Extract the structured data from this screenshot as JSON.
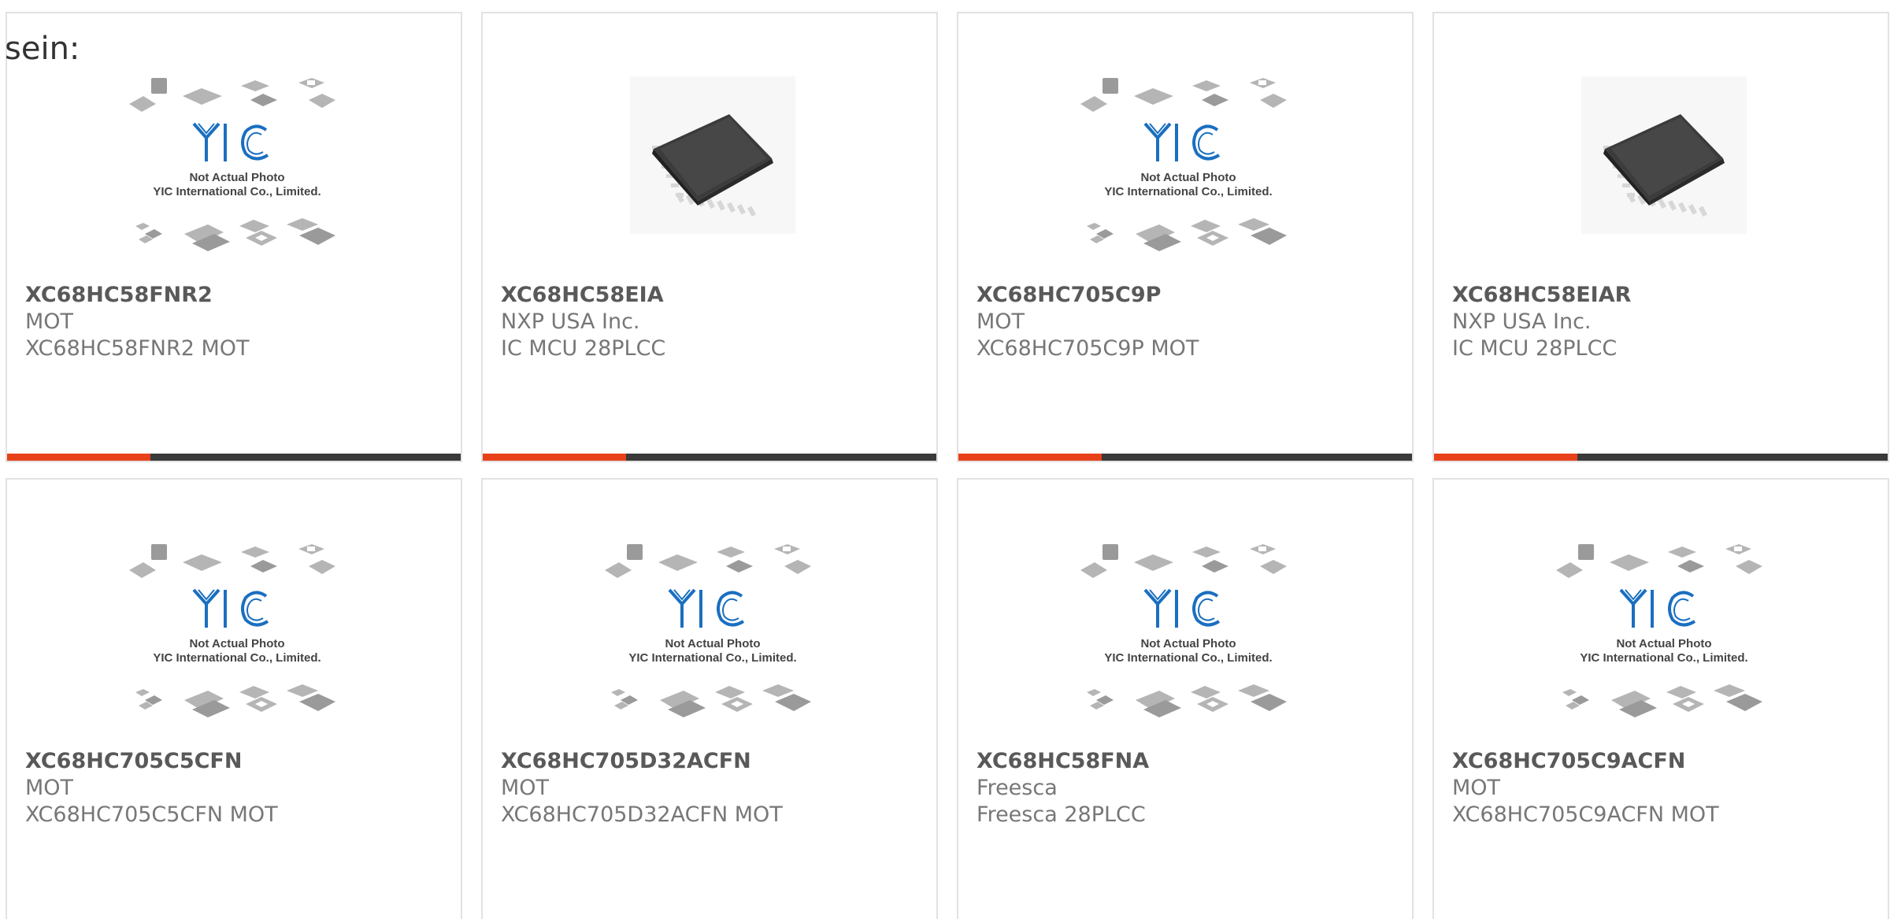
{
  "intro": {
    "text": "sein:"
  },
  "colors": {
    "accent": "#e8411a",
    "bar": "#3a3a3a",
    "logo": "#1a6fc0"
  },
  "placeholder": {
    "line1": "Not Actual Photo",
    "line2": "YIC International Co., Limited.",
    "logo": "YIC"
  },
  "products": [
    {
      "part": "XC68HC58FNR2",
      "maker": "MOT",
      "desc": "XC68HC58FNR2 MOT",
      "image": "placeholder"
    },
    {
      "part": "XC68HC58EIA",
      "maker": "NXP USA Inc.",
      "desc": "IC MCU 28PLCC",
      "image": "chip-photo"
    },
    {
      "part": "XC68HC705C9P",
      "maker": "MOT",
      "desc": "XC68HC705C9P MOT",
      "image": "placeholder"
    },
    {
      "part": "XC68HC58EIAR",
      "maker": "NXP USA Inc.",
      "desc": "IC MCU 28PLCC",
      "image": "chip-photo"
    },
    {
      "part": "XC68HC705C5CFN",
      "maker": "MOT",
      "desc": "XC68HC705C5CFN MOT",
      "image": "placeholder"
    },
    {
      "part": "XC68HC705D32ACFN",
      "maker": "MOT",
      "desc": "XC68HC705D32ACFN MOT",
      "image": "placeholder"
    },
    {
      "part": "XC68HC58FNA",
      "maker": "Freesca",
      "desc": "Freesca 28PLCC",
      "image": "placeholder"
    },
    {
      "part": "XC68HC705C9ACFN",
      "maker": "MOT",
      "desc": "XC68HC705C9ACFN MOT",
      "image": "placeholder"
    }
  ]
}
